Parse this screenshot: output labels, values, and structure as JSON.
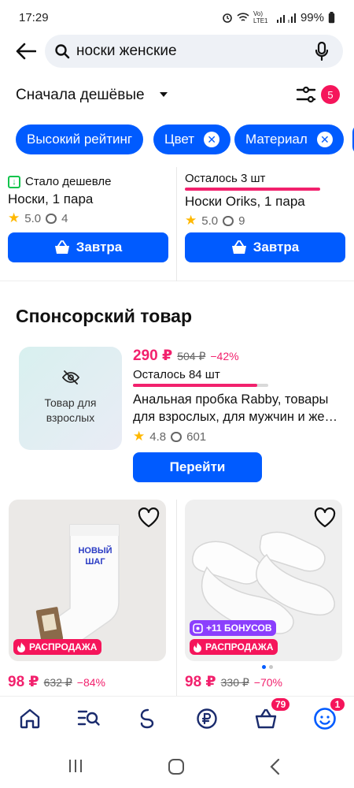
{
  "status": {
    "time": "17:29",
    "battery": "99%",
    "network": "Vo) LTE1"
  },
  "search": {
    "query": "носки женские"
  },
  "sort": {
    "label": "Сначала дешёвые",
    "filter_count": "5"
  },
  "chips": [
    {
      "label": "Высокий рейтинг"
    },
    {
      "label": "Цвет",
      "close": "✕"
    },
    {
      "label": "Материал",
      "close": "✕"
    }
  ],
  "top_cards": [
    {
      "promo": "Стало дешевле",
      "title": "Носки, 1 пара",
      "rating": "5.0",
      "reviews": "4",
      "button": "Завтра"
    },
    {
      "stock": "Осталось 3 шт",
      "title": "Носки Oriks, 1 пара",
      "rating": "5.0",
      "reviews": "9",
      "button": "Завтра"
    }
  ],
  "sponsored": {
    "heading": "Спонсорский товар",
    "image_label": "Товар для взрослых",
    "price": "290 ₽",
    "old_price": "504 ₽",
    "discount": "−42%",
    "stock": "Осталось 84 шт",
    "stock_fill": 0.92,
    "title": "Анальная пробка Rabby, товары для взрослых, для мужчин и же…",
    "rating": "4.8",
    "reviews": "601",
    "button": "Перейти"
  },
  "grid": [
    {
      "sock_text": "НОВЫЙ ШАГ",
      "sale": "РАСПРОДАЖА",
      "price": "98 ₽",
      "old_price": "632 ₽",
      "discount": "−84%"
    },
    {
      "bonus": "+11 БОНУСОВ",
      "sale": "РАСПРОДАЖА",
      "price": "98 ₽",
      "old_price": "330 ₽",
      "discount": "−70%"
    }
  ],
  "nav": {
    "cart_badge": "79",
    "profile_badge": "1"
  },
  "colors": {
    "accent": "#005bff",
    "sale": "#f5155b",
    "bonus": "#8b3ffd"
  }
}
